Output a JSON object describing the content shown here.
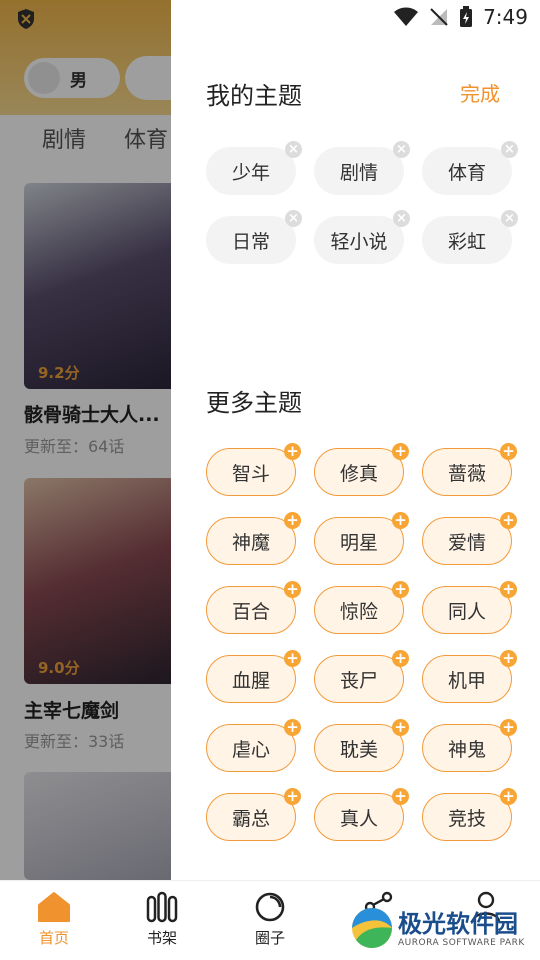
{
  "background": {
    "gender_label": "男",
    "categories": [
      "剧情",
      "体育"
    ],
    "books": [
      {
        "title": "骸骨骑士大人...",
        "update": "更新至：64话",
        "score": "9.2分"
      },
      {
        "title": "主宰七魔剑",
        "update": "更新至：33话",
        "score": "9.0分"
      }
    ]
  },
  "status_bar": {
    "time": "7:49"
  },
  "drawer": {
    "my_title": "我的主题",
    "done_label": "完成",
    "my_tags": [
      "少年",
      "剧情",
      "体育",
      "日常",
      "轻小说",
      "彩虹"
    ],
    "more_title": "更多主题",
    "more_tags": [
      "智斗",
      "修真",
      "蔷薇",
      "神魔",
      "明星",
      "爱情",
      "百合",
      "惊险",
      "同人",
      "血腥",
      "丧尸",
      "机甲",
      "虐心",
      "耽美",
      "神鬼",
      "霸总",
      "真人",
      "竞技"
    ]
  },
  "tabbar": {
    "tabs": [
      {
        "label": "首页",
        "icon": "home-icon"
      },
      {
        "label": "书架",
        "icon": "bookshelf-icon"
      },
      {
        "label": "圈子",
        "icon": "circle-icon"
      }
    ]
  },
  "watermark": {
    "name": "极光软件园",
    "sub": "AURORA SOFTWARE PARK"
  },
  "colors": {
    "accent": "#f0922e",
    "tag_more_bg": "#fff4e6",
    "tag_more_border": "#f29a3a",
    "tag_mine_bg": "#f3f3f3"
  }
}
